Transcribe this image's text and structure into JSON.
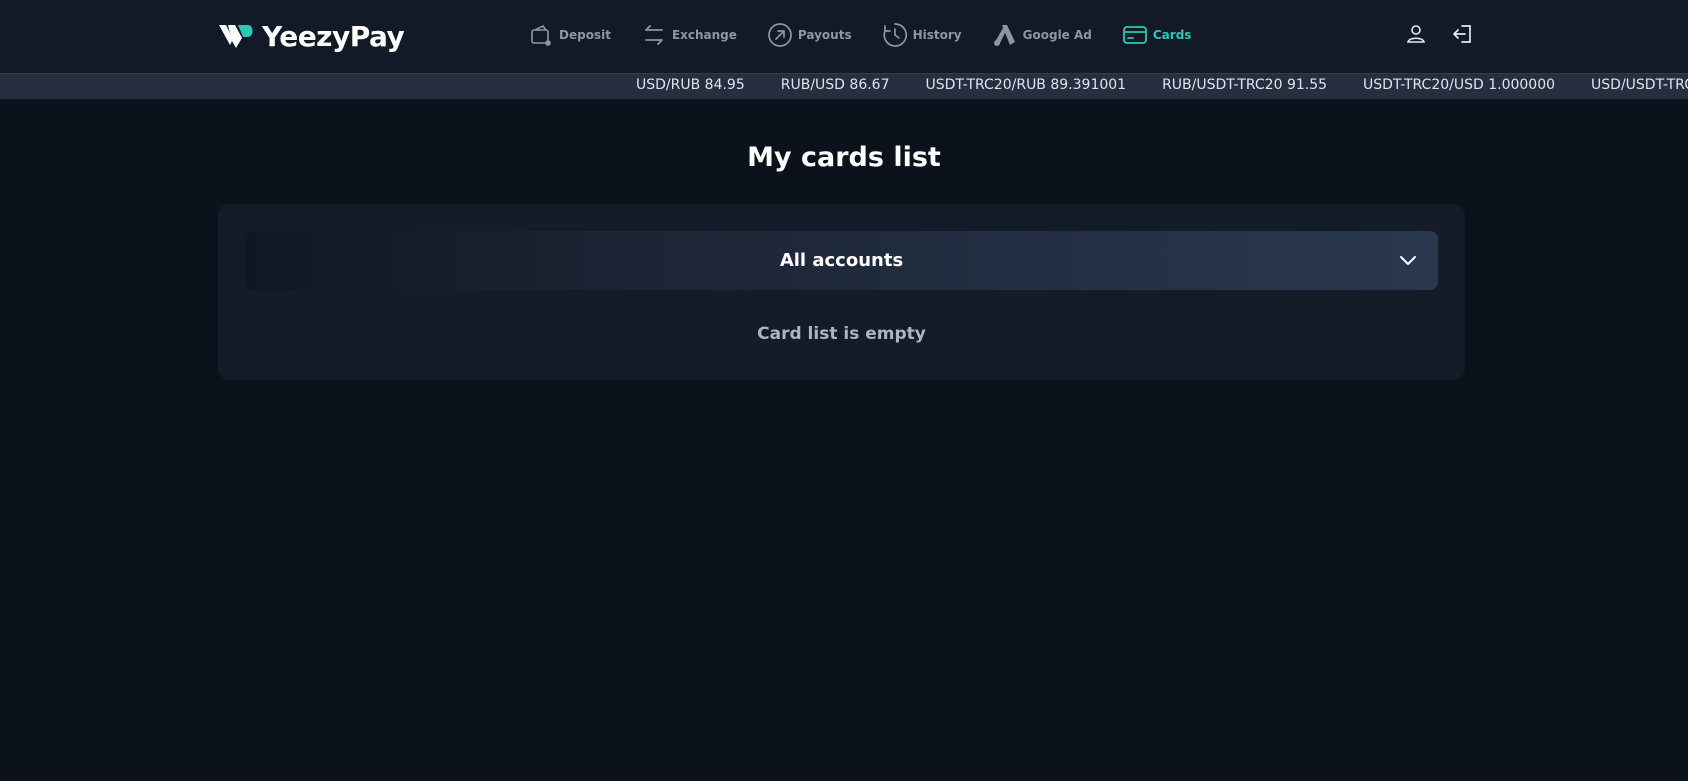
{
  "brand": {
    "name": "YeezyPay",
    "accent_color": "#2fc6b4"
  },
  "nav": {
    "items": [
      {
        "label": "Deposit",
        "icon": "wallet-icon"
      },
      {
        "label": "Exchange",
        "icon": "exchange-arrows-icon"
      },
      {
        "label": "Payouts",
        "icon": "arrow-up-right-circle-icon"
      },
      {
        "label": "History",
        "icon": "history-clock-icon"
      },
      {
        "label": "Google Ad",
        "icon": "google-ads-icon"
      },
      {
        "label": "Cards",
        "icon": "credit-card-icon",
        "active": true
      }
    ]
  },
  "header_actions": {
    "profile_icon": "user-icon",
    "logout_icon": "logout-icon"
  },
  "ticker": {
    "rates": [
      "USD/RUB 84.95",
      "RUB/USD 86.67",
      "USDT-TRC20/RUB 89.391001",
      "RUB/USDT-TRC20 91.55",
      "USDT-TRC20/USD 1.000000",
      "USD/USDT-TRC"
    ]
  },
  "page": {
    "title": "My cards list",
    "account_select": {
      "value": "All accounts",
      "icon": "chevron-down-icon"
    },
    "empty_message": "Card list is empty"
  }
}
